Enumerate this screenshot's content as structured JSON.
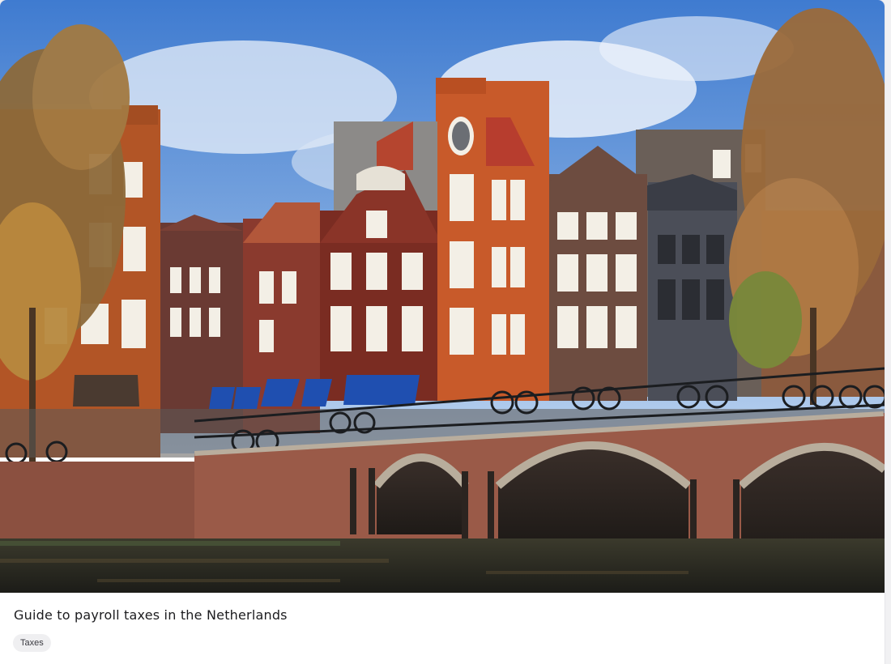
{
  "card": {
    "image_alt": "Amsterdam canal houses and brick bridge",
    "title": "Guide to payroll taxes in the Netherlands",
    "tag": "Taxes"
  },
  "colors": {
    "sky": "#5b8fd6",
    "brick_orange": "#c85a2a",
    "bridge_brick": "#9a5a48",
    "water": "#2a2a22",
    "awning_blue": "#1f4fb0",
    "tag_bg": "#efeff1"
  }
}
